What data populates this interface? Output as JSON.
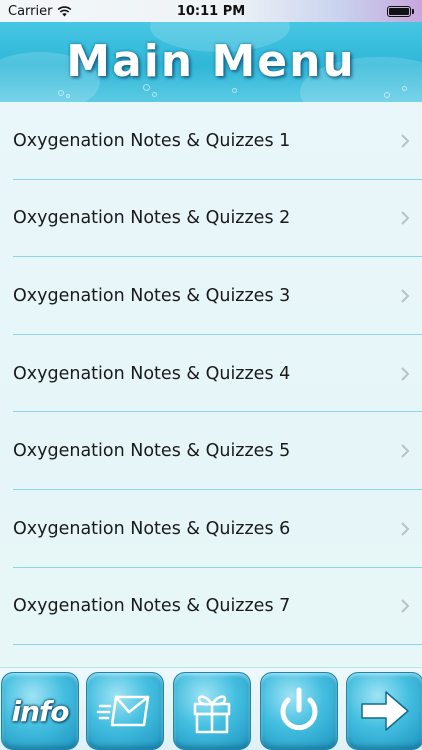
{
  "status_bar": {
    "carrier": "Carrier",
    "time": "10:11 PM"
  },
  "header": {
    "title": "Main Menu"
  },
  "menu": {
    "items": [
      {
        "label": "Oxygenation Notes & Quizzes 1"
      },
      {
        "label": "Oxygenation Notes & Quizzes 2"
      },
      {
        "label": "Oxygenation Notes & Quizzes 3"
      },
      {
        "label": "Oxygenation Notes & Quizzes 4"
      },
      {
        "label": "Oxygenation Notes & Quizzes 5"
      },
      {
        "label": "Oxygenation Notes & Quizzes 6"
      },
      {
        "label": "Oxygenation Notes & Quizzes 7"
      }
    ]
  },
  "toolbar": {
    "info_label": "info",
    "buttons": [
      {
        "icon": "info-icon"
      },
      {
        "icon": "email-icon"
      },
      {
        "icon": "gift-icon"
      },
      {
        "icon": "power-icon"
      },
      {
        "icon": "arrow-right-icon"
      }
    ]
  },
  "colors": {
    "header": "#2fb7d8",
    "divider": "#8dd6e8",
    "background": "#e8f7f8",
    "button": "#44bfe0"
  }
}
